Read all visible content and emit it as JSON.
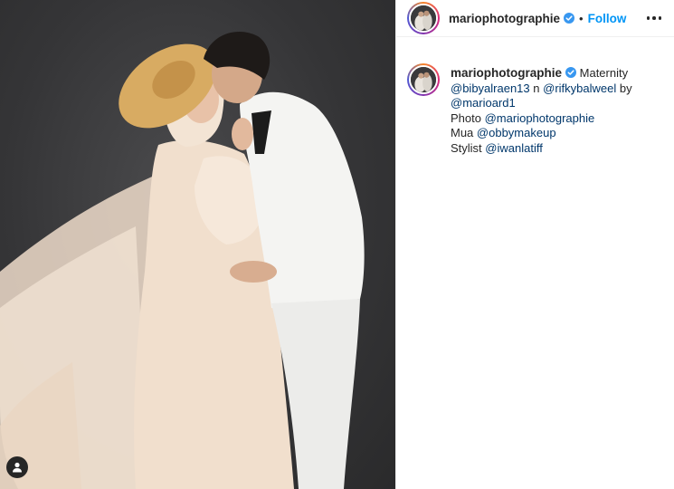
{
  "post": {
    "username": "mariophotographie",
    "verified": true,
    "separator": "•",
    "follow_label": "Follow",
    "more_icon": "more-options-icon",
    "tag_icon": "user-tag-icon"
  },
  "caption": {
    "username": "mariophotographie",
    "text_1": "Maternity",
    "mention_1": "@bibyalraen13",
    "connector": "n",
    "mention_2": "@rifkybalweel",
    "by": "by",
    "mention_3": "@marioard1",
    "photo_label": "Photo",
    "mention_4": "@mariophotographie",
    "mua_label": "Mua",
    "mention_5": "@obbymakeup",
    "stylist_label": "Stylist",
    "mention_6": "@iwanlatiff"
  },
  "colors": {
    "link": "#0095f6",
    "mention": "#00376b",
    "text": "#262626",
    "backdrop": "#3a3a3c"
  }
}
